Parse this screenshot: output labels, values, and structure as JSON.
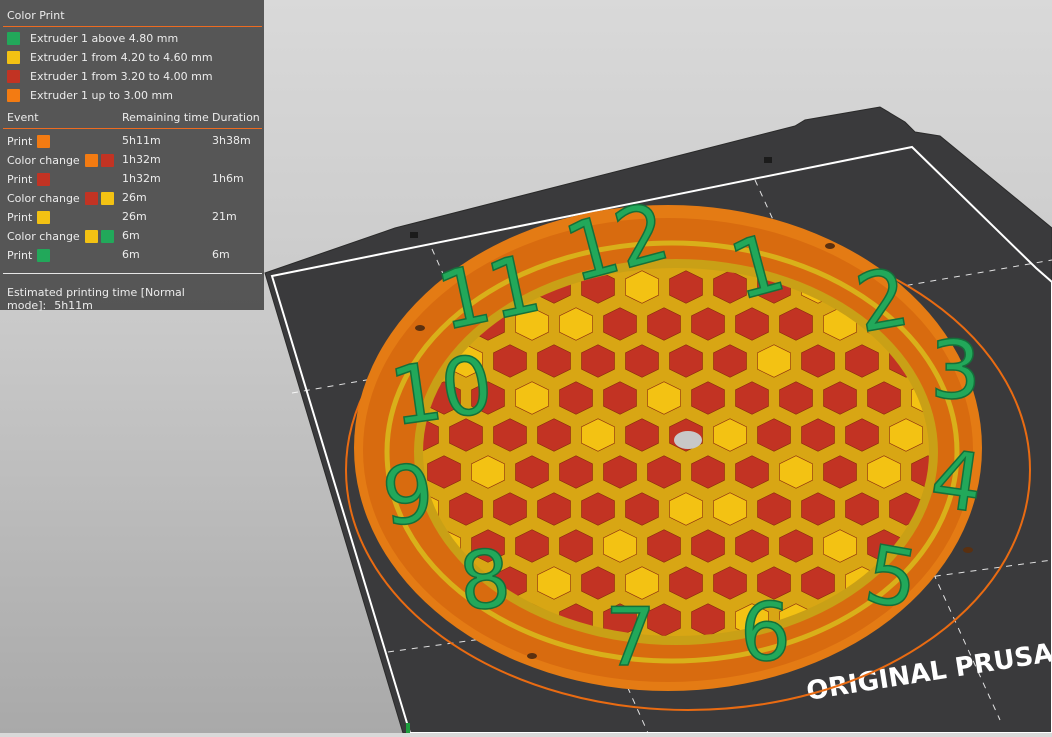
{
  "colors": {
    "green": "#22a85a",
    "yellow": "#f3c213",
    "red": "#c23323",
    "orange": "#f37b12"
  },
  "panel": {
    "title": "Color Print",
    "legend": [
      {
        "color": "#22a85a",
        "label": "Extruder 1 above 4.80 mm"
      },
      {
        "color": "#f3c213",
        "label": "Extruder 1 from 4.20 to 4.60 mm"
      },
      {
        "color": "#c23323",
        "label": "Extruder 1 from 3.20 to 4.00 mm"
      },
      {
        "color": "#f37b12",
        "label": "Extruder 1 up to 3.00 mm"
      }
    ],
    "columns": {
      "event": "Event",
      "remaining": "Remaining time",
      "duration": "Duration"
    },
    "events": [
      {
        "event": "Print",
        "swatches": [
          "#f37b12"
        ],
        "remaining": "5h11m",
        "duration": "3h38m"
      },
      {
        "event": "Color change",
        "swatches": [
          "#f37b12",
          "#c23323"
        ],
        "remaining": "1h32m",
        "duration": ""
      },
      {
        "event": "Print",
        "swatches": [
          "#c23323"
        ],
        "remaining": "1h32m",
        "duration": "1h6m"
      },
      {
        "event": "Color change",
        "swatches": [
          "#c23323",
          "#f3c213"
        ],
        "remaining": "26m",
        "duration": ""
      },
      {
        "event": "Print",
        "swatches": [
          "#f3c213"
        ],
        "remaining": "26m",
        "duration": "21m"
      },
      {
        "event": "Color change",
        "swatches": [
          "#f3c213",
          "#22a85a"
        ],
        "remaining": "6m",
        "duration": ""
      },
      {
        "event": "Print",
        "swatches": [
          "#22a85a"
        ],
        "remaining": "6m",
        "duration": "6m"
      }
    ],
    "estimate_label": "Estimated printing time [Normal mode]:",
    "estimate_value": "5h11m"
  },
  "scene": {
    "bed_text": "ORIGINAL PRUSA",
    "clock_numbers": [
      "1",
      "2",
      "3",
      "4",
      "5",
      "6",
      "7",
      "8",
      "9",
      "10",
      "11",
      "12"
    ]
  }
}
